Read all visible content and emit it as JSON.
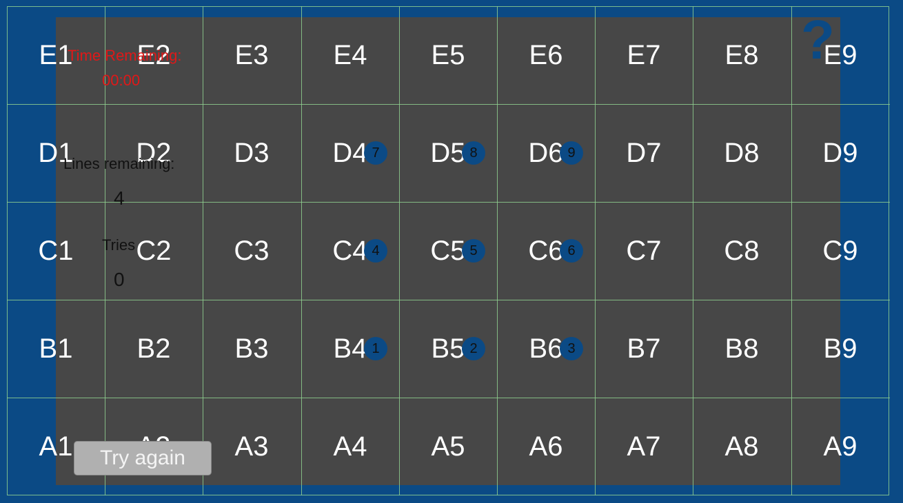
{
  "colors": {
    "background": "#0b4a85",
    "panel": "#474747",
    "grid": "#8fd08f",
    "timer": "#e01818",
    "cell_text": "#ffffff"
  },
  "help": {
    "icon": "question-mark-icon",
    "glyph": "?"
  },
  "timer": {
    "label": "Time Remaining:",
    "value": "00:00"
  },
  "lines": {
    "label": "Lines remaining:",
    "value": "4"
  },
  "tries": {
    "label": "Tries",
    "value": "0"
  },
  "try_again": {
    "label": "Try again"
  },
  "grid": {
    "rows": [
      [
        "E1",
        "E2",
        "E3",
        "E4",
        "E5",
        "E6",
        "E7",
        "E8",
        "E9"
      ],
      [
        "D1",
        "D2",
        "D3",
        "D4",
        "D5",
        "D6",
        "D7",
        "D8",
        "D9"
      ],
      [
        "C1",
        "C2",
        "C3",
        "C4",
        "C5",
        "C6",
        "C7",
        "C8",
        "C9"
      ],
      [
        "B1",
        "B2",
        "B3",
        "B4",
        "B5",
        "B6",
        "B7",
        "B8",
        "B9"
      ],
      [
        "A1",
        "A2",
        "A3",
        "A4",
        "A5",
        "A6",
        "A7",
        "A8",
        "A9"
      ]
    ]
  },
  "dots": [
    {
      "cell": "B4",
      "label": "1"
    },
    {
      "cell": "B5",
      "label": "2"
    },
    {
      "cell": "B6",
      "label": "3"
    },
    {
      "cell": "C4",
      "label": "4"
    },
    {
      "cell": "C5",
      "label": "5"
    },
    {
      "cell": "C6",
      "label": "6"
    },
    {
      "cell": "D4",
      "label": "7"
    },
    {
      "cell": "D5",
      "label": "8"
    },
    {
      "cell": "D6",
      "label": "9"
    }
  ]
}
